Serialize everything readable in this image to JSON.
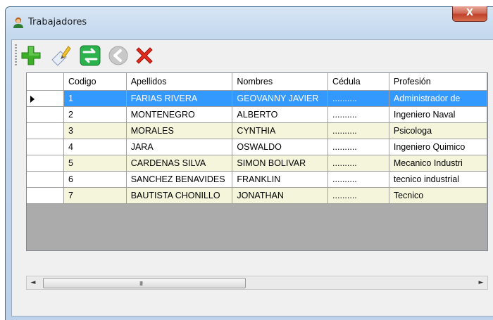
{
  "window": {
    "title": "Trabajadores",
    "close_label": "X"
  },
  "toolbar": {
    "buttons": [
      {
        "name": "add-button",
        "icon": "plus-icon"
      },
      {
        "name": "edit-button",
        "icon": "pencil-icon"
      },
      {
        "name": "transfer-button",
        "icon": "swap-arrows-icon"
      },
      {
        "name": "back-button",
        "icon": "back-arrow-icon"
      },
      {
        "name": "delete-button",
        "icon": "red-x-icon"
      }
    ]
  },
  "grid": {
    "columns": [
      "Codigo",
      "Apellidos",
      "Nombres",
      "Cédula",
      "Profesión"
    ],
    "rows": [
      [
        "1",
        "FARIAS RIVERA",
        "GEOVANNY JAVIER",
        "..........",
        "Administrador de"
      ],
      [
        "2",
        "MONTENEGRO",
        "ALBERTO",
        "..........",
        "Ingeniero Naval"
      ],
      [
        "3",
        "MORALES",
        "CYNTHIA",
        "..........",
        "Psicologa"
      ],
      [
        "4",
        "JARA",
        "OSWALDO",
        "..........",
        "Ingeniero Quimico"
      ],
      [
        "5",
        "CARDENAS SILVA",
        "SIMON BOLIVAR",
        "..........",
        "Mecanico Industri"
      ],
      [
        "6",
        "SANCHEZ BENAVIDES",
        "FRANKLIN",
        "..........",
        "tecnico industrial"
      ],
      [
        "7",
        "BAUTISTA CHONILLO",
        "JONATHAN",
        "..........",
        "Tecnico"
      ]
    ],
    "selected_row": 0
  },
  "scrollbar": {
    "left": "◄",
    "right": "►",
    "grip": "III"
  },
  "colors": {
    "selection": "#3399ff",
    "alt_row": "#f5f5dc"
  }
}
